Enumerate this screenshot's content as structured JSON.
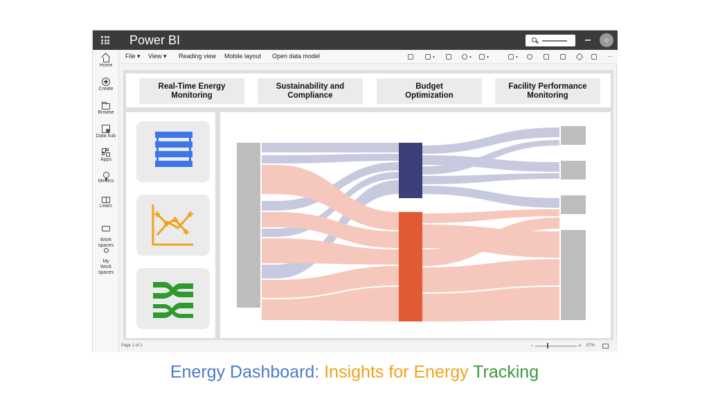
{
  "window": {
    "app_title": "Power BI"
  },
  "nav_rail": {
    "items": [
      {
        "label": "Home"
      },
      {
        "label": "Create"
      },
      {
        "label": "Browse"
      },
      {
        "label": "Data hub"
      },
      {
        "label": "Apps"
      },
      {
        "label": "Metrics"
      },
      {
        "label": "Learn"
      },
      {
        "label": "Work\nspaces"
      },
      {
        "label": "My\nWork\nspaces"
      }
    ]
  },
  "toolbar": {
    "file": "File",
    "view": "View",
    "reading_view": "Reading view",
    "mobile_layout": "Mobile layout",
    "open_data_model": "Open data model"
  },
  "report": {
    "tabs": [
      "Real-Time Energy\nMonitoring",
      "Sustainability and\nCompliance",
      "Budget\nOptimization",
      "Facility Performance\nMonitoring"
    ],
    "icon_cards": [
      "list-icon",
      "chart-icon",
      "flow-icon"
    ],
    "sankey": {
      "flow_colors": {
        "blue": "#b7bbd6",
        "salmon": "#f2b5a6"
      },
      "node_colors": {
        "source": "#bdbdbd",
        "blue_node": "#3b3f7a",
        "orange_node": "#e05a33",
        "targets": "#bdbdbd"
      }
    }
  },
  "status": {
    "page": "Page 1 of 1",
    "zoom_minus": "-",
    "zoom_plus": "+",
    "zoom": "57%"
  },
  "caption": {
    "part1": "Energy Dashboard:",
    "part2": "Insights for Energy",
    "part3": "Tracking",
    "colors": {
      "part1": "#4a7ac9",
      "part2": "#f0a21b",
      "part3": "#3a9a3a"
    }
  }
}
